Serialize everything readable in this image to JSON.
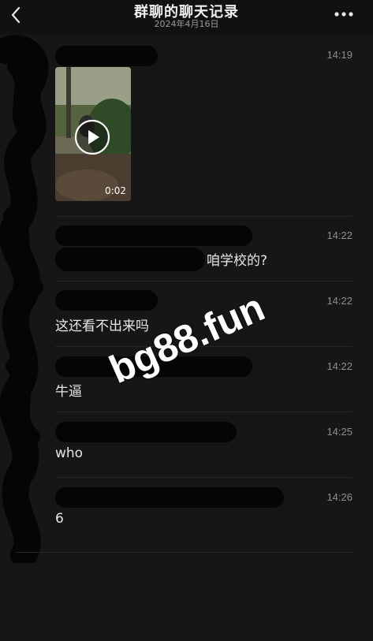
{
  "header": {
    "title": "群聊的聊天记录",
    "date": "2024年4月16日",
    "back_icon": "chevron-left-icon",
    "more_icon": "more-dots-icon"
  },
  "messages": [
    {
      "time": "14:19",
      "type": "video",
      "duration": "0:02"
    },
    {
      "time": "14:22",
      "text": "咱学校的?"
    },
    {
      "time": "14:22",
      "text": "这还看不出来吗"
    },
    {
      "time": "14:22",
      "text": "牛逼"
    },
    {
      "time": "14:25",
      "text": "who"
    },
    {
      "time": "14:26",
      "text": "6"
    }
  ],
  "watermark": "bg88.fun",
  "colors": {
    "background": "#161616",
    "header": "#111111",
    "text": "#e6e6e6",
    "time": "#8e8e8e"
  }
}
